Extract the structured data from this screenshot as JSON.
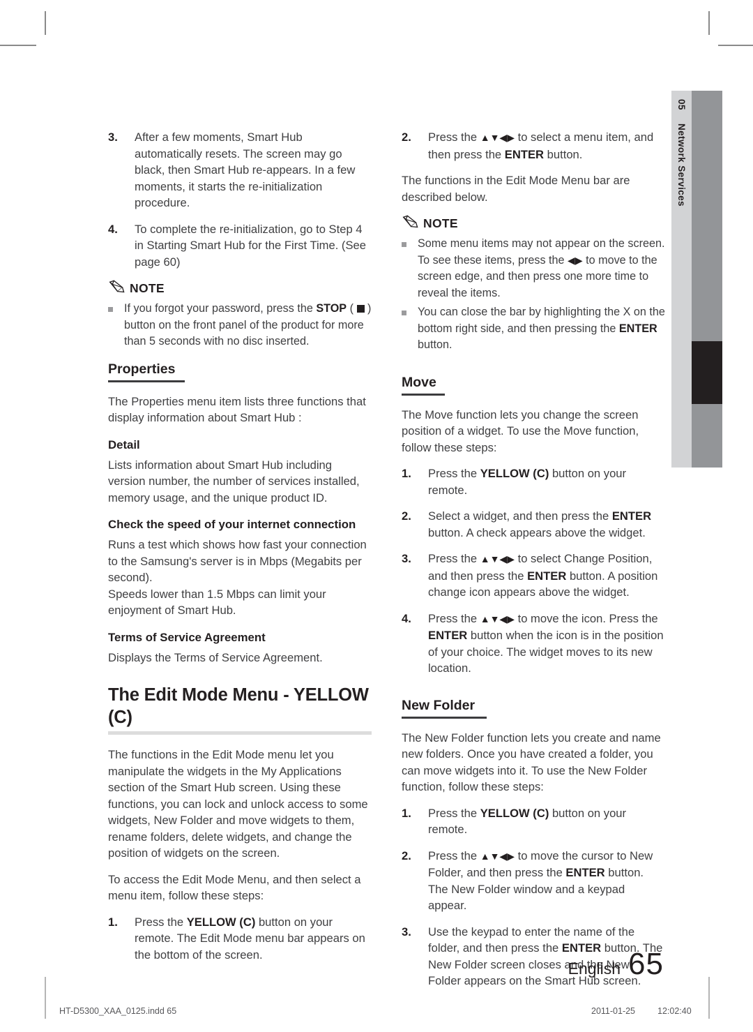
{
  "document": {
    "language_label": "English",
    "page_number": "65",
    "print_file": "HT-D5300_XAA_0125.indd   65",
    "print_date": "2011-01-25",
    "print_time": "12:02:40"
  },
  "side_tab": {
    "chapter_number": "05",
    "chapter_name": "Network Services"
  },
  "icons": {
    "note": "pencil-icon",
    "bullet": "square-bullet-icon",
    "stop": "stop-square-icon",
    "arrows_updownleftright": "▲▼◀▶",
    "arrows_leftright": "◀▶"
  },
  "left_column": {
    "steps_continued": [
      {
        "num": "3.",
        "text": "After a few moments, Smart Hub automatically resets. The screen may go black, then Smart Hub re-appears. In a few moments, it starts the re-initialization procedure."
      },
      {
        "num": "4.",
        "text": "To complete the re-initialization, go to Step 4 in Starting Smart Hub for the First Time. (See page 60)"
      }
    ],
    "note": {
      "label": "NOTE",
      "items": [
        {
          "part1": "If you forgot your password, press the ",
          "bold1": "STOP",
          "part2": " ( ",
          "part3": " ) button on the front panel of the product for more than 5 seconds with no disc inserted."
        }
      ]
    },
    "properties": {
      "heading": "Properties",
      "intro": "The Properties menu item lists three functions that display information about Smart Hub :",
      "detail": {
        "heading": "Detail",
        "text": "Lists information about Smart Hub including version number, the number of services installed, memory usage, and the unique product ID."
      },
      "speed": {
        "heading": "Check the speed of your internet connection",
        "text1": "Runs a test which shows how fast your connection to the Samsung's server is in Mbps (Megabits per second).",
        "text2": "Speeds lower than 1.5 Mbps can limit your enjoyment of Smart Hub."
      },
      "terms": {
        "heading": "Terms of Service Agreement",
        "text": "Displays the Terms of Service Agreement."
      }
    },
    "edit_mode": {
      "heading": "The Edit Mode Menu - YELLOW (C)",
      "para1": "The functions in the Edit Mode menu let you manipulate the widgets in the My Applications section of the Smart Hub screen. Using these functions, you can lock and unlock access to some widgets, New Folder and move widgets to them, rename folders, delete widgets, and change the position of widgets on the screen.",
      "para2": "To access the Edit Mode Menu, and then select a menu item, follow these steps:",
      "step1": {
        "num": "1.",
        "pre": "Press the ",
        "bold": "YELLOW (C)",
        "post": " button on your remote. The Edit Mode menu bar appears on the bottom of the screen."
      }
    }
  },
  "right_column": {
    "step2": {
      "num": "2.",
      "pre": "Press the ",
      "mid": " to select a menu item, and then press the ",
      "bold": "ENTER",
      "post": " button."
    },
    "intro": "The functions in the Edit Mode Menu bar are described below.",
    "note": {
      "label": "NOTE",
      "item1": {
        "pre": "Some menu items may not appear on the screen. To see these items, press the ",
        "post": " to move to the screen edge, and then press one more time to reveal the items."
      },
      "item2": {
        "pre": "You can close the bar by highlighting the X on the bottom right side, and then pressing the ",
        "bold": "ENTER",
        "post": " button."
      }
    },
    "move": {
      "heading": "Move",
      "intro": "The Move function lets you change the screen position of a widget. To use the Move function, follow these steps:",
      "step1": {
        "num": "1.",
        "pre": "Press the ",
        "bold": "YELLOW (C)",
        "post": " button on your remote."
      },
      "step2": {
        "num": "2.",
        "pre": "Select a widget, and then press the ",
        "bold": "ENTER",
        "post": " button. A check appears above the widget."
      },
      "step3": {
        "num": "3.",
        "pre": "Press the ",
        "mid": " to select Change Position, and then press the ",
        "bold": "ENTER",
        "post": " button. A position change icon appears above the widget."
      },
      "step4": {
        "num": "4.",
        "pre": "Press the ",
        "mid": " to move the icon. Press the ",
        "bold": "ENTER",
        "post": " button when the icon is in the position of your choice. The widget moves to its new location."
      }
    },
    "new_folder": {
      "heading": "New Folder",
      "intro": "The New Folder function lets you create and name new folders. Once you have created a folder, you can move widgets into it. To use the New Folder function, follow these steps:",
      "step1": {
        "num": "1.",
        "pre": "Press the ",
        "bold": "YELLOW (C)",
        "post": " button on your remote."
      },
      "step2": {
        "num": "2.",
        "pre": "Press the ",
        "mid": " to move the cursor to New Folder, and then press the ",
        "bold": "ENTER",
        "post": " button. The New Folder window and a keypad appear."
      },
      "step3": {
        "num": "3.",
        "pre": "Use the keypad to enter the name of the folder, and then press the ",
        "bold": "ENTER",
        "post": " button. The New Folder screen closes and the New Folder appears on the Smart Hub screen."
      }
    }
  },
  "colors": {
    "text": "#3f3f41",
    "bold_text": "#231f20",
    "tab_light": "#d2d3d5",
    "tab_dark": "#939598",
    "tab_black": "#231f20",
    "rule_major": "#dcdcdc",
    "rule_sub": "#3c3c3e"
  }
}
